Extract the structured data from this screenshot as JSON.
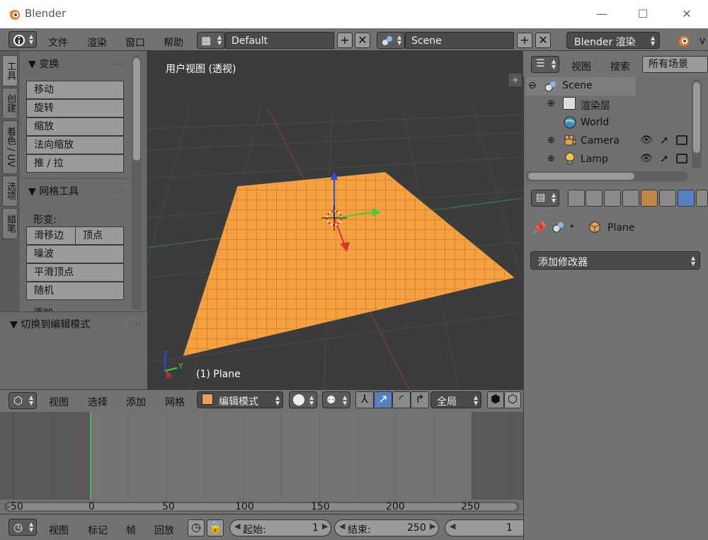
{
  "window": {
    "title": "Blender",
    "controls": [
      "—",
      "☐",
      "✕"
    ]
  },
  "topbar": {
    "menus": [
      "文件",
      "渲染",
      "窗口",
      "帮助"
    ],
    "layout_value": "Default",
    "scene_value": "Scene",
    "engine_value": "Blender 渲染",
    "version_fragment": "v"
  },
  "toolshelf": {
    "tabs": [
      "工具",
      "创建",
      "着色 / UV",
      "选项",
      "蜡笔"
    ],
    "transform_title": "▼ 变换",
    "transform_buttons": [
      "移动",
      "旋转",
      "缩放",
      "法向缩放",
      "推 / 拉"
    ],
    "mesh_tools_title": "▼ 网格工具",
    "deform_label": "形变:",
    "slide_edge": "滑移边",
    "vertex": "顶点",
    "mesh_buttons": [
      "噪波",
      "平滑顶点",
      "随机"
    ],
    "add_label_partial": "添加",
    "toggle_edit_title": "▼ 切换到编辑模式"
  },
  "viewport": {
    "view_label": "用户视图 (透视)",
    "object_label": "(1) Plane",
    "axis_labels": [
      "Z",
      "Y",
      "X"
    ]
  },
  "outliner": {
    "menus": [
      "视图",
      "搜索"
    ],
    "filter_value": "所有场景",
    "items": [
      {
        "label": "Scene",
        "icon": "scene-icon"
      },
      {
        "label": "渲染层",
        "icon": "render-layers-icon"
      },
      {
        "label": "World",
        "icon": "world-icon"
      },
      {
        "label": "Camera",
        "icon": "camera-icon"
      },
      {
        "label": "Lamp",
        "icon": "lamp-icon"
      }
    ]
  },
  "properties": {
    "object_name": "Plane",
    "add_modifier": "添加修改器"
  },
  "view3d_header": {
    "menus": [
      "视图",
      "选择",
      "添加",
      "网格"
    ],
    "mode_value": "编辑模式",
    "orientation_value": "全局"
  },
  "timeline": {
    "ticks": [
      "-50",
      "0",
      "50",
      "100",
      "150",
      "200",
      "250"
    ],
    "menus": [
      "视图",
      "标记",
      "帧",
      "回放"
    ],
    "start_label": "起始:",
    "start_value": "1",
    "end_label": "结束:",
    "end_value": "250",
    "current_value": "1"
  },
  "colors": {
    "accent": "#5680c2",
    "selection_orange": "#f5a142",
    "viewport_bg": "#3c3c3c",
    "panel_bg": "#727272",
    "frame_green": "#3fbf3f"
  }
}
